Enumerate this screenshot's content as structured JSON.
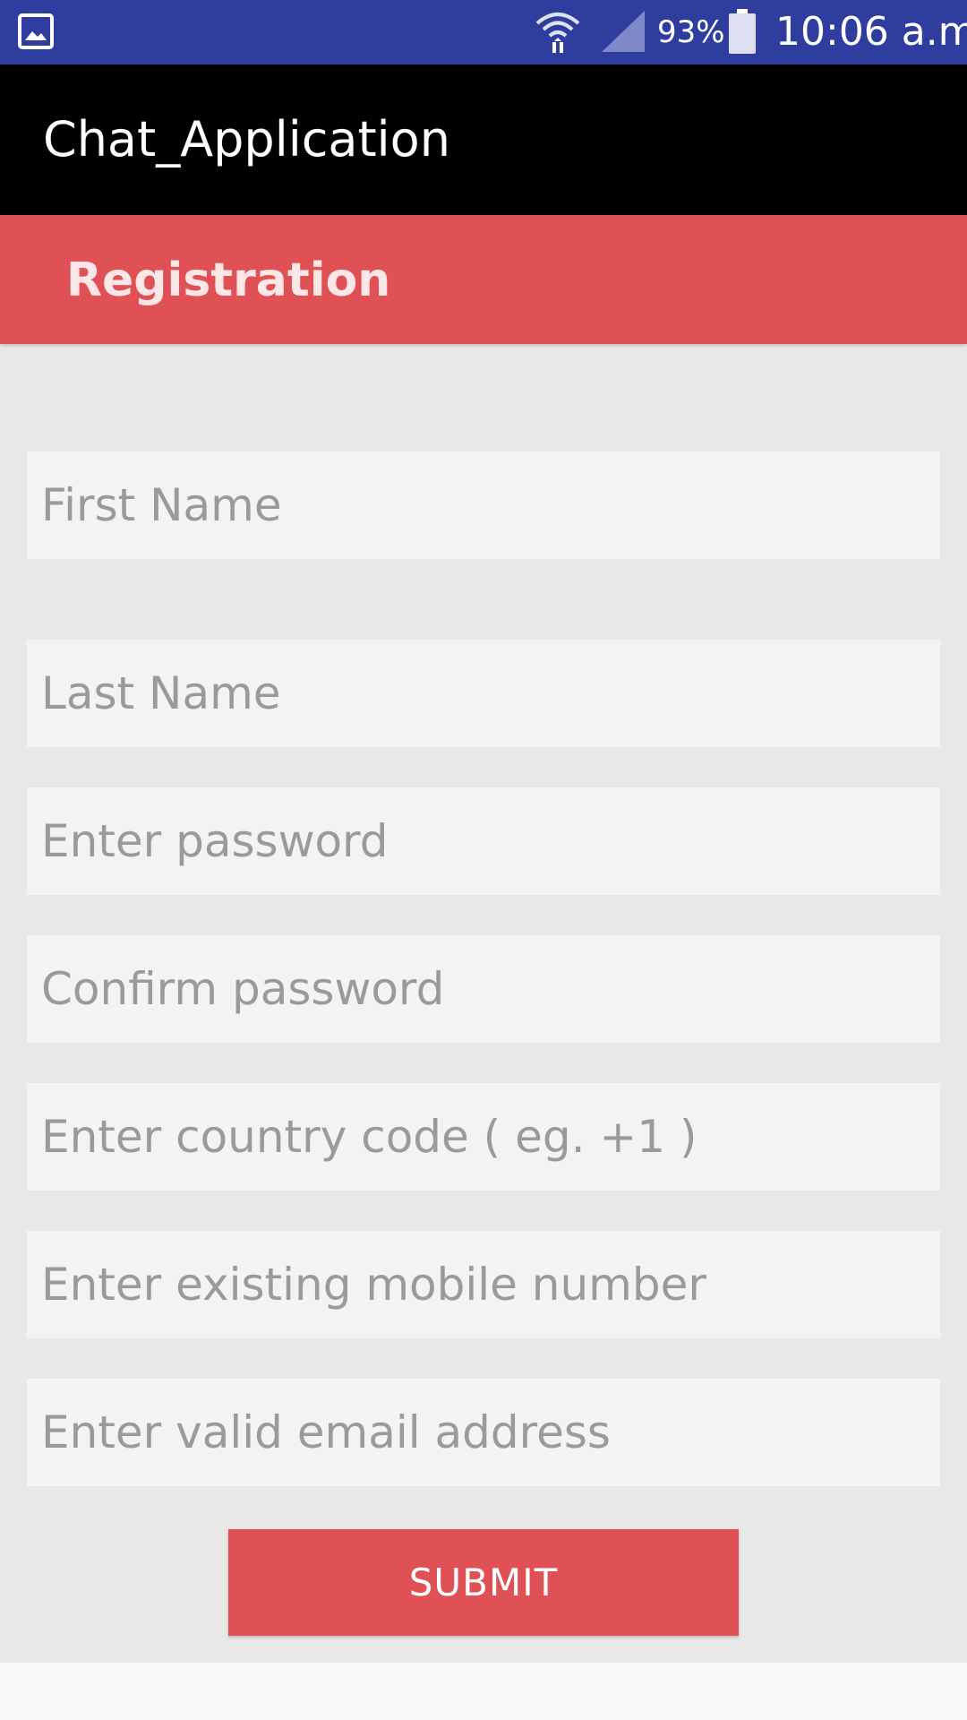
{
  "status_bar": {
    "battery_percent": "93%",
    "time": "10:06 a.m.",
    "icons": [
      "image-icon",
      "wifi-icon",
      "signal-icon",
      "battery-icon"
    ],
    "background_color": "#2f3e9e"
  },
  "app_bar": {
    "title": "Chat_Application",
    "background_color": "#000000"
  },
  "registration": {
    "heading": "Registration",
    "accent_color": "#e05155"
  },
  "form": {
    "fields": [
      {
        "name": "first-name-input",
        "placeholder": "First Name",
        "value": ""
      },
      {
        "name": "last-name-input",
        "placeholder": "Last Name",
        "value": ""
      },
      {
        "name": "password-input",
        "placeholder": "Enter password",
        "value": ""
      },
      {
        "name": "confirm-password-input",
        "placeholder": "Confirm password",
        "value": ""
      },
      {
        "name": "country-code-input",
        "placeholder": "Enter country code ( eg. +1 )",
        "value": ""
      },
      {
        "name": "mobile-number-input",
        "placeholder": "Enter existing mobile number",
        "value": ""
      },
      {
        "name": "email-input",
        "placeholder": "Enter valid email address",
        "value": ""
      }
    ],
    "submit_label": "SUBMIT"
  }
}
